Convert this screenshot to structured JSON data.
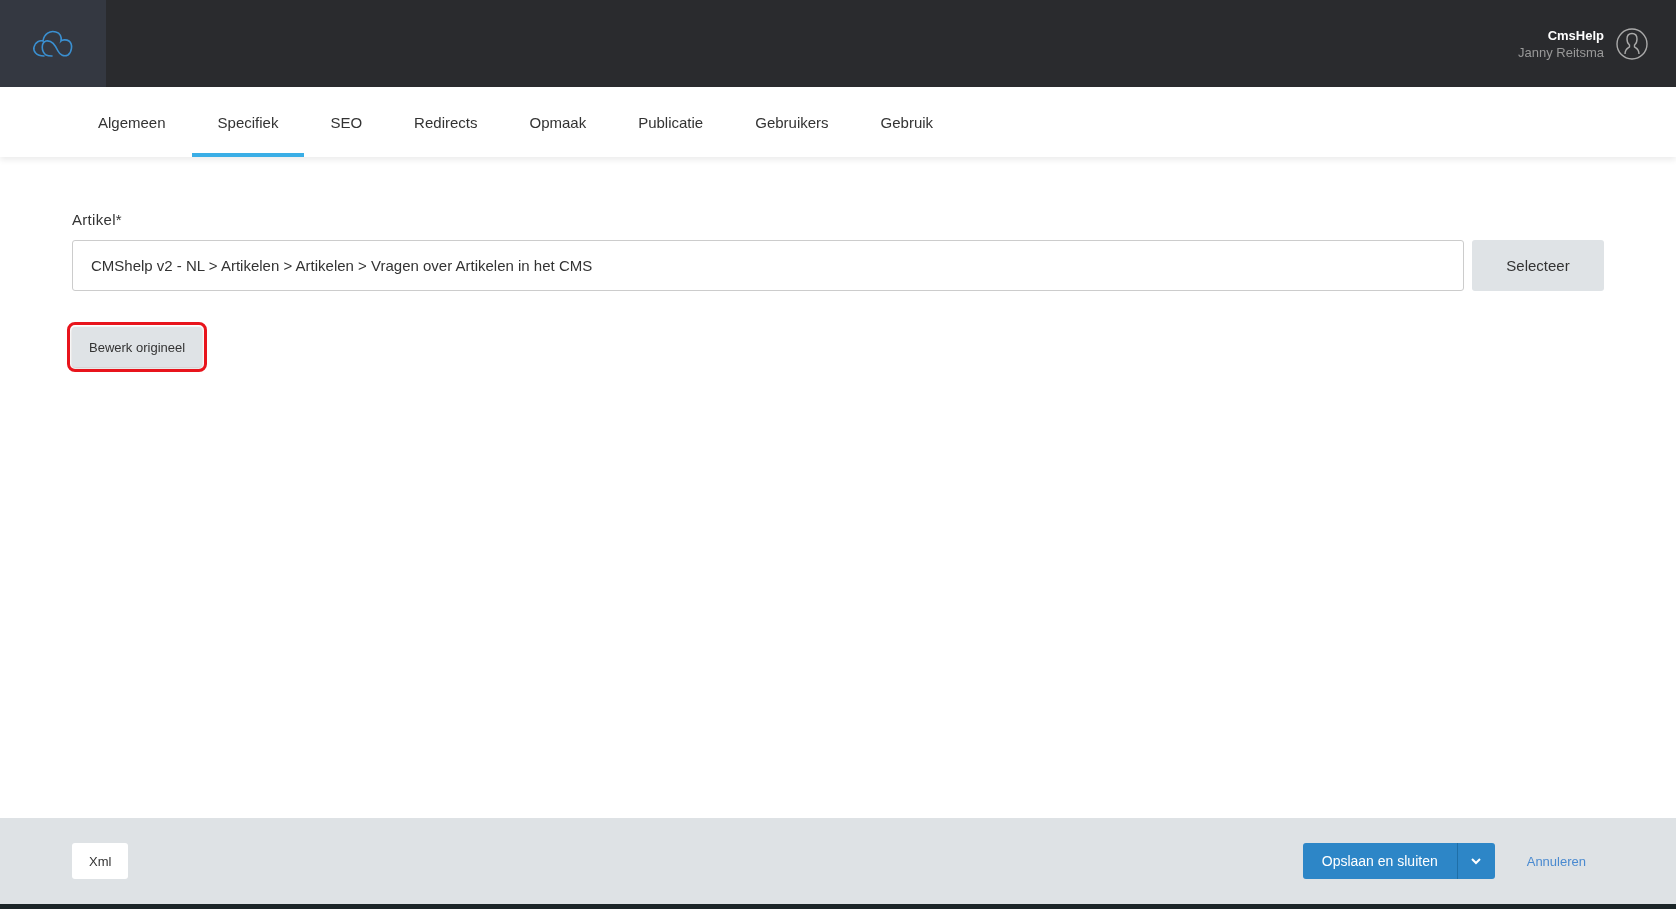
{
  "header": {
    "user": {
      "site": "CmsHelp",
      "name": "Janny Reitsma"
    }
  },
  "tabs": [
    {
      "label": "Algemeen",
      "selected": false
    },
    {
      "label": "Specifiek",
      "selected": true
    },
    {
      "label": "SEO",
      "selected": false
    },
    {
      "label": "Redirects",
      "selected": false
    },
    {
      "label": "Opmaak",
      "selected": false
    },
    {
      "label": "Publicatie",
      "selected": false
    },
    {
      "label": "Gebruikers",
      "selected": false
    },
    {
      "label": "Gebruik",
      "selected": false
    }
  ],
  "form": {
    "label": "Artikel*",
    "value": "CMShelp v2 - NL > Artikelen > Artikelen > Vragen over Artikelen in het CMS",
    "select_button": "Selecteer",
    "edit_button": {
      "label": "Bewerk origineel",
      "highlighted": true
    }
  },
  "footer": {
    "xml_button": "Xml",
    "save_button": "Opslaan en sluiten",
    "cancel_link": "Annuleren"
  }
}
